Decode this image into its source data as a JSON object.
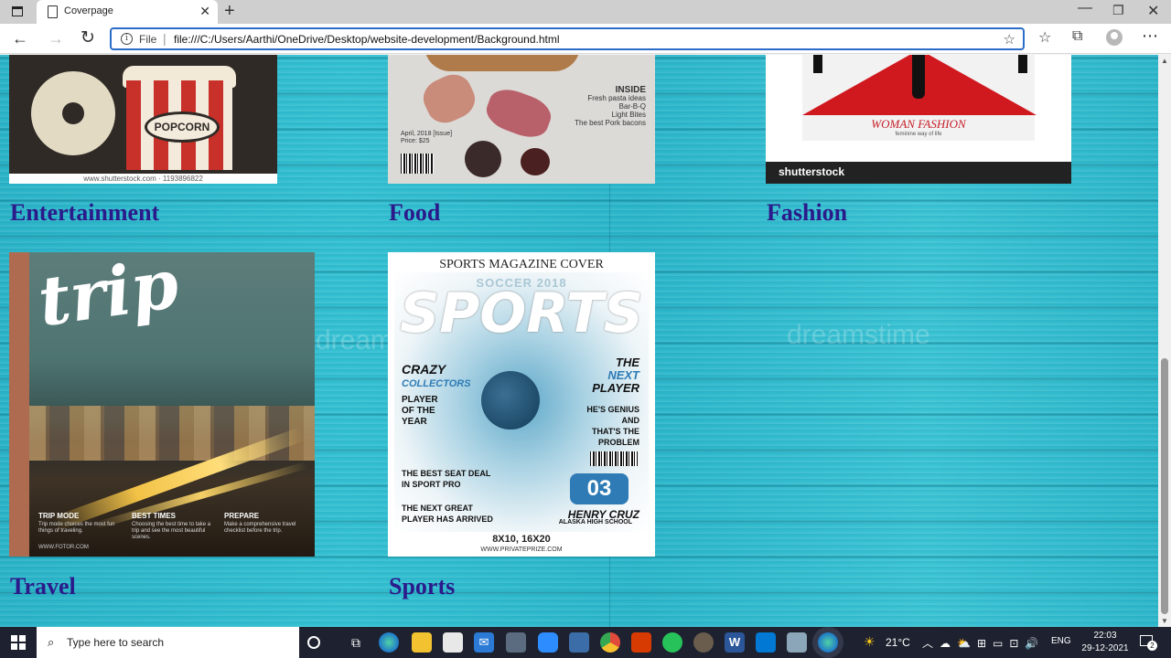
{
  "browser": {
    "tab_title": "Coverpage",
    "tab_close": "✕",
    "new_tab": "+",
    "address_scheme": "File",
    "address_url": "file:///C:/Users/Aarthi/OneDrive/Desktop/website-development/Background.html",
    "window_min": "—",
    "window_max": "❐",
    "window_close": "✕"
  },
  "page": {
    "watermark": "dreamstime",
    "cards": [
      {
        "caption": "Entertainment",
        "cover_credit": "www.shutterstock.com · 1193896822",
        "cover_popcorn": "POPCORN"
      },
      {
        "caption": "Food",
        "cover_inside_title": "INSIDE",
        "cover_inside_lines": [
          "Fresh pasta ideas",
          "Bar-B-Q",
          "Light Bites",
          "The best Pork bacons"
        ],
        "cover_issue": "April, 2018 [Issue]",
        "cover_price": "Price: $25"
      },
      {
        "caption": "Fashion",
        "cover_name": "WOMAN FASHION",
        "cover_sub": "feminine way of life",
        "cover_brand": "shutterstock"
      },
      {
        "caption": "Travel",
        "cover_title": "trip",
        "cover_cols": [
          {
            "h": "TRIP MODE",
            "d": "Trip mode choices the most fun things of traveling."
          },
          {
            "h": "BEST TIMES",
            "d": "Choosing the best time to take a trip and see the most beautiful scenes."
          },
          {
            "h": "PREPARE",
            "d": "Make a comprehensive travel checklist before the trip."
          }
        ],
        "cover_site": "WWW.FOTOR.COM"
      },
      {
        "caption": "Sports",
        "cover_top": "SPORTS MAGAZINE COVER",
        "cover_soccer": "SOCCER 2018",
        "cover_big": "SPORTS",
        "cover_crazy": "CRAZY",
        "cover_collectors": "COLLECTORS",
        "cover_poy": [
          "PLAYER",
          "OF THE",
          "YEAR"
        ],
        "cover_next": [
          "THE",
          "NEXT",
          "PLAYER"
        ],
        "cover_genius": [
          "HE'S GENIUS",
          "AND",
          "THAT'S THE",
          "PROBLEM"
        ],
        "cover_seat": [
          "THE BEST SEAT DEAL",
          "IN SPORT PRO"
        ],
        "cover_arrive": [
          "THE NEXT GREAT",
          "PLAYER HAS ARRIVED"
        ],
        "cover_number": "03",
        "cover_henry": "HENRY CRUZ",
        "cover_school": "ALASKA HIGH SCHOOL",
        "cover_size": "8X10, 16X20",
        "cover_site": "WWW.PRIVATEPRIZE.COM"
      }
    ]
  },
  "taskbar": {
    "search_placeholder": "Type here to search",
    "word_label": "W",
    "temperature": "21°C",
    "language": "ENG",
    "time": "22:03",
    "date": "29-12-2021",
    "notification_count": "2"
  }
}
